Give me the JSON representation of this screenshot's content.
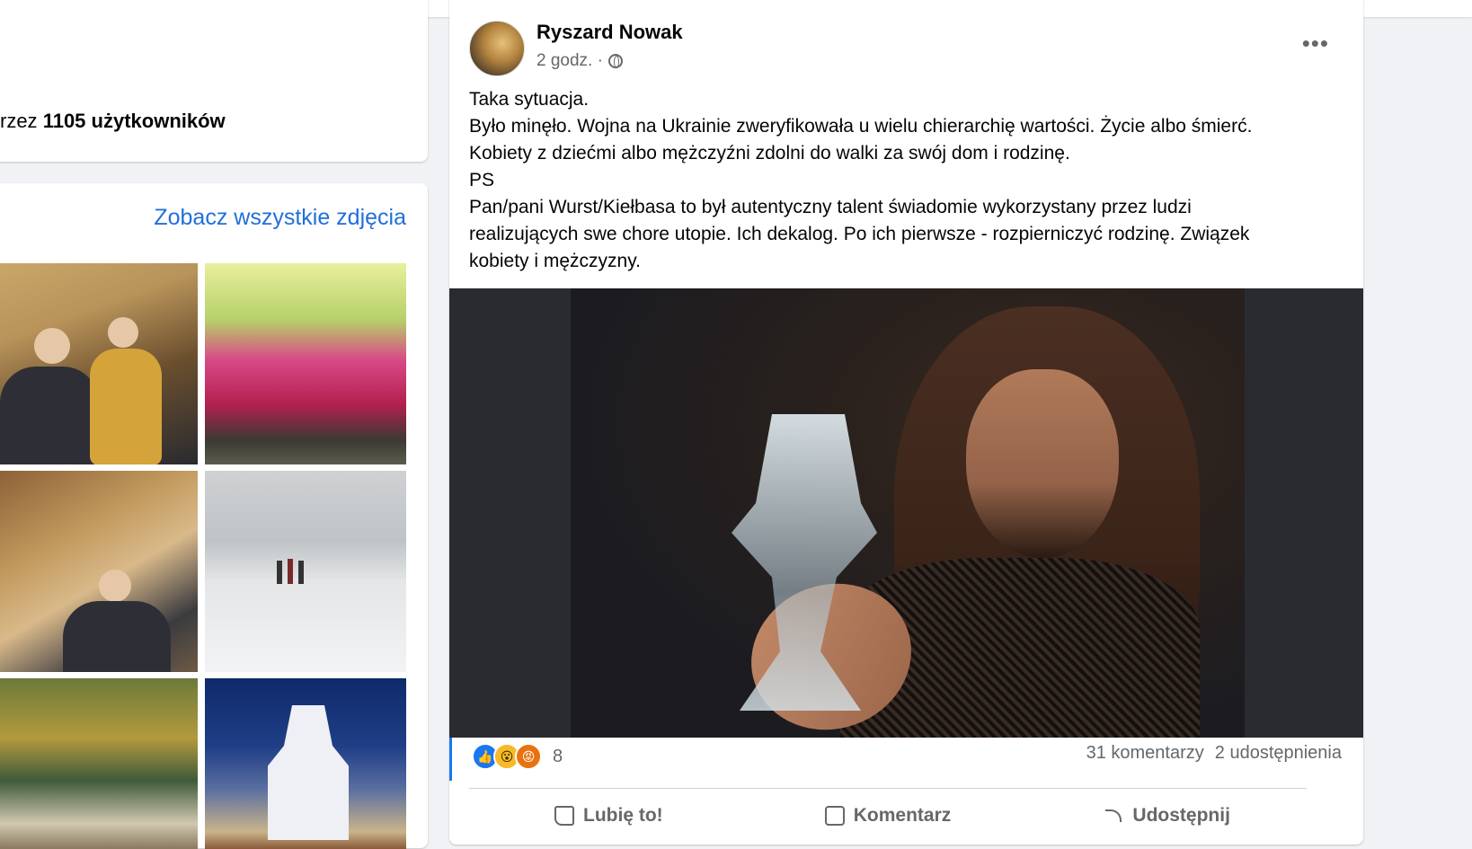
{
  "intro": {
    "followers_prefix": "rzez",
    "followers_count": "1105",
    "followers_suffix": "użytkowników"
  },
  "photos": {
    "see_all_label": "Zobacz wszystkie zdjęcia"
  },
  "post": {
    "author": "Ryszard Nowak",
    "time": "2 godz. ·",
    "lines": [
      "Taka sytuacja.",
      "Było minęło. Wojna na Ukrainie zweryfikowała u wielu chierarchię wartości. Życie albo śmierć.",
      "Kobiety z dziećmi albo mężczyźni zdolni do walki za swój dom i rodzinę.",
      "PS",
      "Pan/pani Wurst/Kiełbasa to był autentyczny  talent świadomie wykorzystany przez ludzi",
      "realizujących swe chore utopie. Ich dekalog. Po ich  pierwsze - rozpierniczyć rodzinę. Związek",
      "kobiety i mężczyzny."
    ],
    "reaction_count": "8",
    "comments": "31 komentarzy",
    "shares": "2 udostępnienia",
    "actions": {
      "like": "Lubię to!",
      "comment": "Komentarz",
      "share": "Udostępnij"
    }
  },
  "icons": {
    "reaction_icons": [
      "like-icon",
      "wow-icon",
      "angry-icon"
    ],
    "more": "more-icon",
    "privacy": "globe-icon"
  },
  "colors": {
    "accent": "#216fdb",
    "like": "#1877f2",
    "wow": "#f7b928",
    "angry": "#e9710f"
  }
}
